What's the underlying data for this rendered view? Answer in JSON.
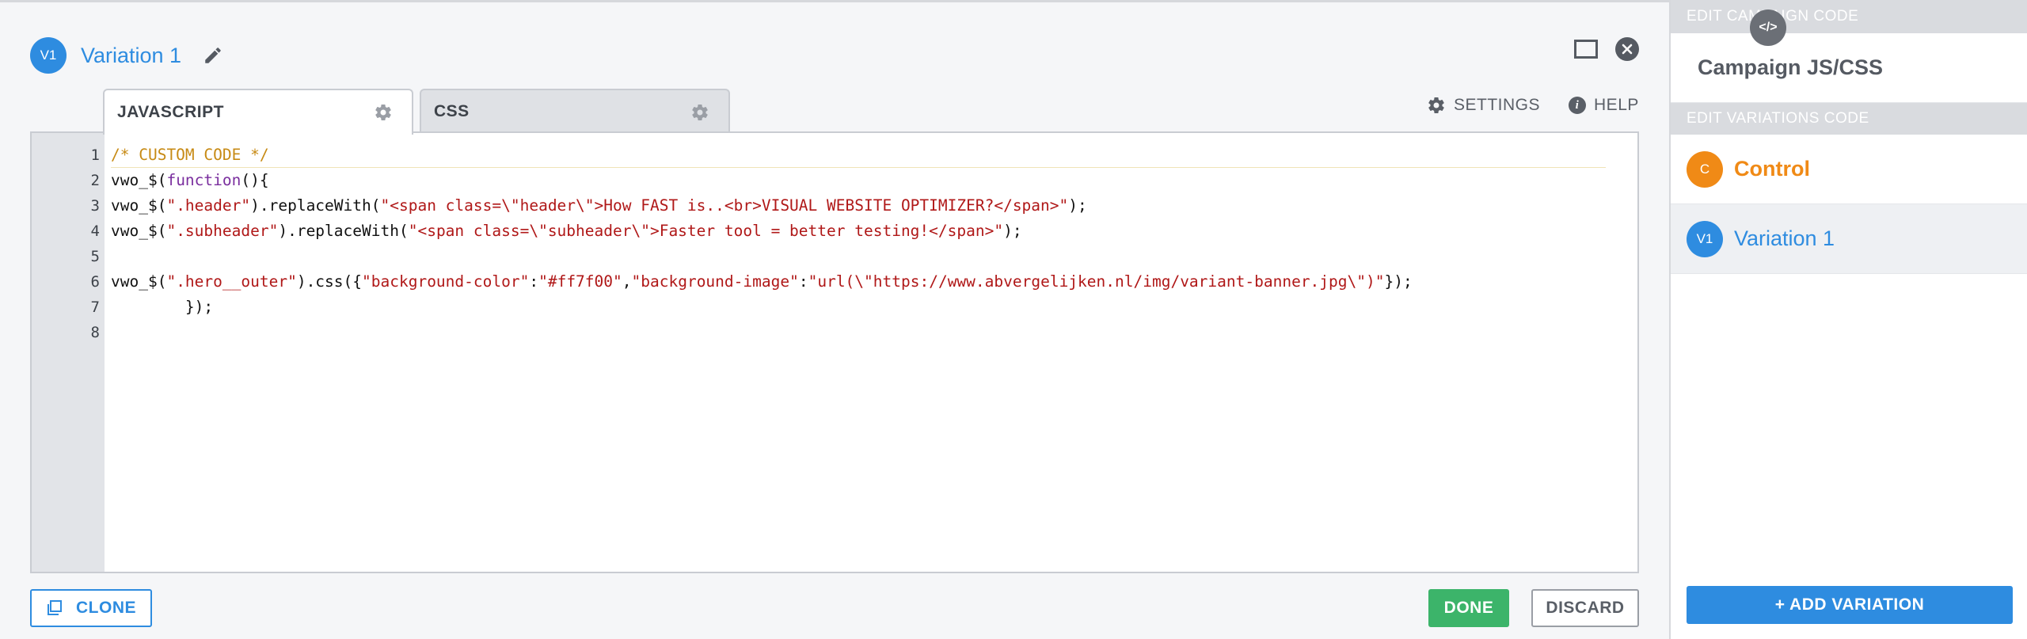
{
  "header": {
    "badge": "V1",
    "title": "Variation 1",
    "pencil_icon": "pencil-icon",
    "maximize_icon": "maximize-icon",
    "close_icon": "close-icon"
  },
  "tabs": [
    {
      "label": "JAVASCRIPT",
      "icon": "gear-icon",
      "active": true
    },
    {
      "label": "CSS",
      "icon": "gear-icon",
      "active": false
    }
  ],
  "tools": {
    "settings": "SETTINGS",
    "help": "HELP"
  },
  "editor": {
    "line_numbers": [
      "1",
      "2",
      "3",
      "4",
      "5",
      "6",
      "7",
      "8"
    ],
    "lines": [
      [
        {
          "t": "/* CUSTOM CODE */",
          "c": "cmt"
        }
      ],
      [
        {
          "t": "vwo_$(",
          "c": ""
        },
        {
          "t": "function",
          "c": "kw"
        },
        {
          "t": "(){",
          "c": ""
        }
      ],
      [
        {
          "t": "vwo_$(",
          "c": ""
        },
        {
          "t": "\".header\"",
          "c": "str"
        },
        {
          "t": ").replaceWith(",
          "c": ""
        },
        {
          "t": "\"<span class=\\\"header\\\">How FAST is..<br>VISUAL WEBSITE OPTIMIZER?</span>\"",
          "c": "str"
        },
        {
          "t": ");",
          "c": ""
        }
      ],
      [
        {
          "t": "vwo_$(",
          "c": ""
        },
        {
          "t": "\".subheader\"",
          "c": "str"
        },
        {
          "t": ").replaceWith(",
          "c": ""
        },
        {
          "t": "\"<span class=\\\"subheader\\\">Faster tool = better testing!</span>\"",
          "c": "str"
        },
        {
          "t": ");",
          "c": ""
        }
      ],
      [],
      [
        {
          "t": "vwo_$(",
          "c": ""
        },
        {
          "t": "\".hero__outer\"",
          "c": "str"
        },
        {
          "t": ").css({",
          "c": ""
        },
        {
          "t": "\"background-color\"",
          "c": "str"
        },
        {
          "t": ":",
          "c": ""
        },
        {
          "t": "\"#ff7f00\"",
          "c": "str"
        },
        {
          "t": ",",
          "c": ""
        },
        {
          "t": "\"background-image\"",
          "c": "str"
        },
        {
          "t": ":",
          "c": ""
        },
        {
          "t": "\"url(\\\"https://www.abvergelijken.nl/img/variant-banner.jpg\\\")\"",
          "c": "str"
        },
        {
          "t": "});",
          "c": ""
        }
      ],
      [
        {
          "t": "        });",
          "c": ""
        }
      ],
      []
    ]
  },
  "footer": {
    "clone": "CLONE",
    "clone_icon": "clone-icon",
    "done": "DONE",
    "discard": "DISCARD"
  },
  "sidebar": {
    "campaign_heading": "EDIT CAMPAIGN CODE",
    "campaign_item": {
      "badge": "</>",
      "label": "Campaign JS/CSS",
      "color": "#6b6f76"
    },
    "variations_heading": "EDIT VARIATIONS CODE",
    "variations": [
      {
        "badge": "C",
        "label": "Control",
        "color": "#f08a16",
        "selected": false
      },
      {
        "badge": "V1",
        "label": "Variation 1",
        "color": "#2e8ce0",
        "selected": true
      }
    ],
    "add_variation": "+ ADD VARIATION"
  },
  "colors": {
    "accent": "#2e8ce0",
    "done": "#3cb46a",
    "control": "#f08a16",
    "comment": "#c78a14",
    "string": "#b01818",
    "keyword": "#7a2e9e"
  }
}
